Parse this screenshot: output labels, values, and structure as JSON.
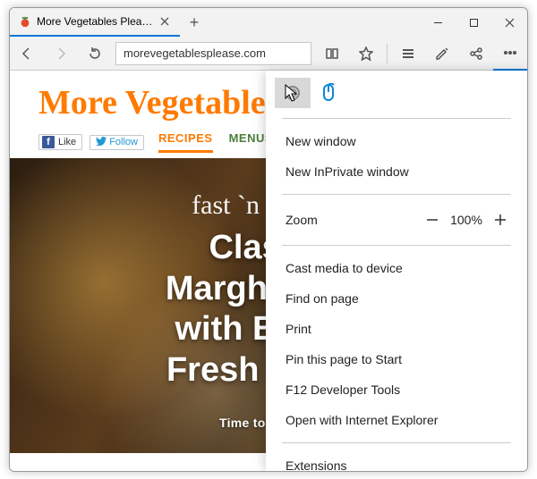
{
  "browser": {
    "tab_title": "More Vegetables Please",
    "address": "morevegetablesplease.com"
  },
  "site": {
    "logo_text": "More Vegetables P",
    "fb_like_label": "Like",
    "tw_follow_label": "Follow",
    "nav": {
      "recipes": "RECIPES",
      "menus": "MENUS"
    },
    "hero_script": "fast `n healthy",
    "hero_title_l1": "Classic",
    "hero_title_l2": "Margherita P",
    "hero_title_l3": "with Basil a",
    "hero_title_l4": "Fresh Mozza",
    "hero_sub": "Time to Prepare"
  },
  "menu": {
    "new_window": "New window",
    "new_inprivate": "New InPrivate window",
    "zoom_label": "Zoom",
    "zoom_value": "100%",
    "cast": "Cast media to device",
    "find": "Find on page",
    "print": "Print",
    "pin": "Pin this page to Start",
    "devtools": "F12 Developer Tools",
    "open_ie": "Open with Internet Explorer",
    "extensions": "Extensions"
  }
}
